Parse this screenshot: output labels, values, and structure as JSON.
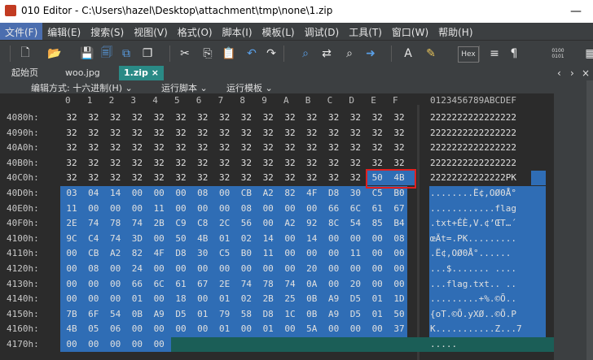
{
  "window": {
    "title": "010 Editor - C:\\Users\\hazel\\Desktop\\attachment\\tmp\\none\\1.zip",
    "minimize": "—"
  },
  "menu": [
    "文件(F)",
    "编辑(E)",
    "搜索(S)",
    "视图(V)",
    "格式(O)",
    "脚本(I)",
    "模板(L)",
    "调试(D)",
    "工具(T)",
    "窗口(W)",
    "帮助(H)"
  ],
  "toolbar_icons": [
    "new-file-icon",
    "open-folder-icon",
    "save-icon",
    "save-all-icon",
    "copy-files-icon",
    "copy-stack-icon",
    "cut-icon",
    "copy-icon",
    "paste-icon",
    "undo-icon",
    "redo-icon",
    "find-icon",
    "replace-icon",
    "find-in-files-icon",
    "goto-icon",
    "font-icon",
    "highlight-icon",
    "hex-icon",
    "sort-icon",
    "pilcrow-icon",
    "binary-icon",
    "calculator-icon"
  ],
  "toolbar_hex_label": "Hex",
  "toolbar_bin_label": "0100\n0101",
  "tabs": [
    "起始页",
    "woo.jpg",
    "1.zip ×"
  ],
  "options": {
    "edit_as": "编辑方式: 十六进制(H) ⌄",
    "run_script": "运行脚本 ⌄",
    "run_template": "运行模板 ⌄"
  },
  "hex": {
    "col_headers": [
      "0",
      "1",
      "2",
      "3",
      "4",
      "5",
      "6",
      "7",
      "8",
      "9",
      "A",
      "B",
      "C",
      "D",
      "E",
      "F"
    ],
    "ascii_header": "0123456789ABCDEF",
    "rows": [
      {
        "addr": "4080h:",
        "bytes": [
          "32",
          "32",
          "32",
          "32",
          "32",
          "32",
          "32",
          "32",
          "32",
          "32",
          "32",
          "32",
          "32",
          "32",
          "32",
          "32"
        ],
        "ascii": "2222222222222222"
      },
      {
        "addr": "4090h:",
        "bytes": [
          "32",
          "32",
          "32",
          "32",
          "32",
          "32",
          "32",
          "32",
          "32",
          "32",
          "32",
          "32",
          "32",
          "32",
          "32",
          "32"
        ],
        "ascii": "2222222222222222"
      },
      {
        "addr": "40A0h:",
        "bytes": [
          "32",
          "32",
          "32",
          "32",
          "32",
          "32",
          "32",
          "32",
          "32",
          "32",
          "32",
          "32",
          "32",
          "32",
          "32",
          "32"
        ],
        "ascii": "2222222222222222"
      },
      {
        "addr": "40B0h:",
        "bytes": [
          "32",
          "32",
          "32",
          "32",
          "32",
          "32",
          "32",
          "32",
          "32",
          "32",
          "32",
          "32",
          "32",
          "32",
          "32",
          "32"
        ],
        "ascii": "2222222222222222"
      },
      {
        "addr": "40C0h:",
        "bytes": [
          "32",
          "32",
          "32",
          "32",
          "32",
          "32",
          "32",
          "32",
          "32",
          "32",
          "32",
          "32",
          "32",
          "32",
          "50",
          "4B"
        ],
        "ascii": "22222222222222PK"
      },
      {
        "addr": "40D0h:",
        "bytes": [
          "03",
          "04",
          "14",
          "00",
          "00",
          "00",
          "08",
          "00",
          "CB",
          "A2",
          "82",
          "4F",
          "D8",
          "30",
          "C5",
          "B0"
        ],
        "ascii": "........Ë¢‚OØ0Å°"
      },
      {
        "addr": "40E0h:",
        "bytes": [
          "11",
          "00",
          "00",
          "00",
          "11",
          "00",
          "00",
          "00",
          "08",
          "00",
          "00",
          "00",
          "66",
          "6C",
          "61",
          "67"
        ],
        "ascii": "............flag"
      },
      {
        "addr": "40F0h:",
        "bytes": [
          "2E",
          "74",
          "78",
          "74",
          "2B",
          "C9",
          "C8",
          "2C",
          "56",
          "00",
          "A2",
          "92",
          "8C",
          "54",
          "85",
          "B4"
        ],
        "ascii": ".txt+ÉÈ,V.¢’ŒT…´"
      },
      {
        "addr": "4100h:",
        "bytes": [
          "9C",
          "C4",
          "74",
          "3D",
          "00",
          "50",
          "4B",
          "01",
          "02",
          "14",
          "00",
          "14",
          "00",
          "00",
          "00",
          "08"
        ],
        "ascii": "œÄt=.PK........."
      },
      {
        "addr": "4110h:",
        "bytes": [
          "00",
          "CB",
          "A2",
          "82",
          "4F",
          "D8",
          "30",
          "C5",
          "B0",
          "11",
          "00",
          "00",
          "00",
          "11",
          "00",
          "00"
        ],
        "ascii": ".Ë¢‚OØ0Å°......"
      },
      {
        "addr": "4120h:",
        "bytes": [
          "00",
          "08",
          "00",
          "24",
          "00",
          "00",
          "00",
          "00",
          "00",
          "00",
          "00",
          "20",
          "00",
          "00",
          "00",
          "00"
        ],
        "ascii": "...$....... ...."
      },
      {
        "addr": "4130h:",
        "bytes": [
          "00",
          "00",
          "00",
          "66",
          "6C",
          "61",
          "67",
          "2E",
          "74",
          "78",
          "74",
          "0A",
          "00",
          "20",
          "00",
          "00"
        ],
        "ascii": "...flag.txt.. .."
      },
      {
        "addr": "4140h:",
        "bytes": [
          "00",
          "00",
          "00",
          "01",
          "00",
          "18",
          "00",
          "01",
          "02",
          "2B",
          "25",
          "0B",
          "A9",
          "D5",
          "01",
          "1D"
        ],
        "ascii": ".........+%.©Õ.."
      },
      {
        "addr": "4150h:",
        "bytes": [
          "7B",
          "6F",
          "54",
          "0B",
          "A9",
          "D5",
          "01",
          "79",
          "58",
          "D8",
          "1C",
          "0B",
          "A9",
          "D5",
          "01",
          "50"
        ],
        "ascii": "{oT.©Õ.yXØ..©Õ.P"
      },
      {
        "addr": "4160h:",
        "bytes": [
          "4B",
          "05",
          "06",
          "00",
          "00",
          "00",
          "00",
          "01",
          "00",
          "01",
          "00",
          "5A",
          "00",
          "00",
          "00",
          "37"
        ],
        "ascii": "K...........Z...7"
      },
      {
        "addr": "4170h:",
        "bytes": [
          "00",
          "00",
          "00",
          "00",
          "00",
          "",
          "",
          "",
          "",
          "",
          "",
          "",
          "",
          "",
          "",
          ""
        ],
        "ascii": "....."
      }
    ]
  },
  "colors": {
    "selection": "#2f6db5",
    "cursor_row": "#1b5e57",
    "highlight_box": "#e02020",
    "accent_tab": "#2a8a86"
  }
}
